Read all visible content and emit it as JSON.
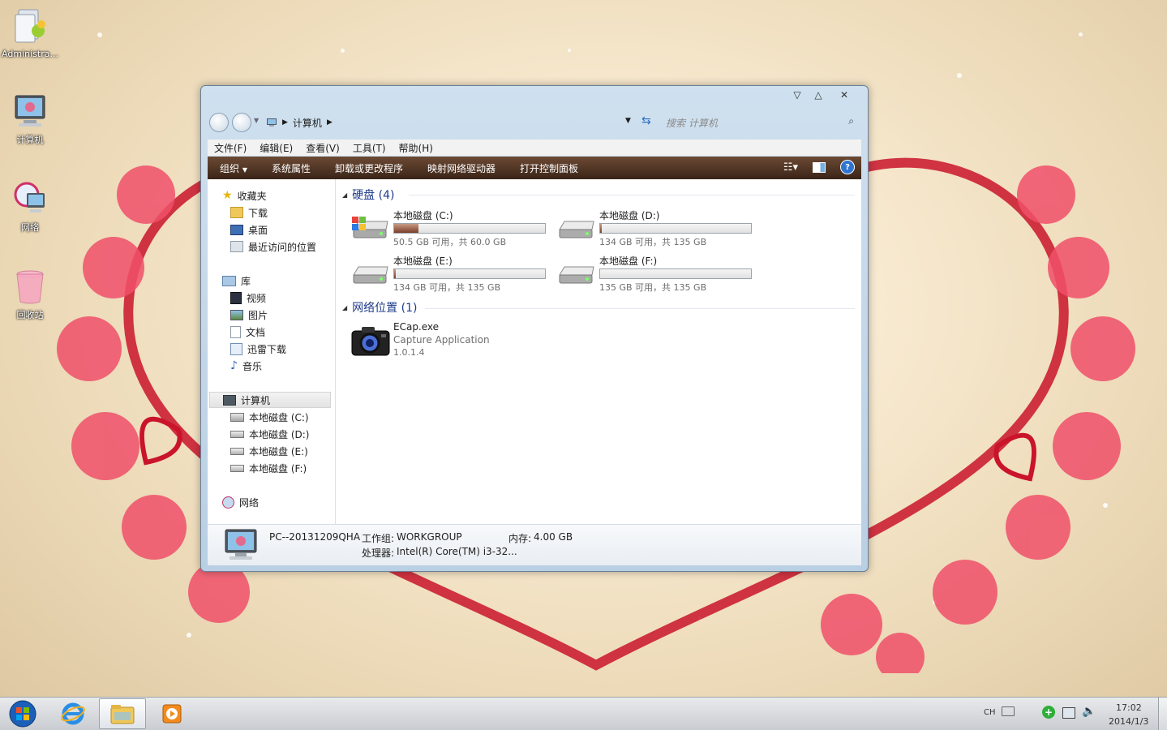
{
  "desktop": {
    "icons": [
      {
        "label": "Administra..."
      },
      {
        "label": "计算机"
      },
      {
        "label": "网络"
      },
      {
        "label": "回收站"
      }
    ]
  },
  "window": {
    "address": {
      "crumb": "计算机"
    },
    "search": {
      "placeholder": "搜索 计算机"
    },
    "menu": [
      "文件(F)",
      "编辑(E)",
      "查看(V)",
      "工具(T)",
      "帮助(H)"
    ],
    "commands": [
      "组织",
      "系统属性",
      "卸载或更改程序",
      "映射网络驱动器",
      "打开控制面板"
    ],
    "nav": {
      "favorites": "收藏夹",
      "favorites_items": [
        "下载",
        "桌面",
        "最近访问的位置"
      ],
      "libraries": "库",
      "library_items": [
        "视频",
        "图片",
        "文档",
        "迅雷下载",
        "音乐"
      ],
      "computer": "计算机",
      "computer_items": [
        "本地磁盘 (C:)",
        "本地磁盘 (D:)",
        "本地磁盘 (E:)",
        "本地磁盘 (F:)"
      ],
      "network": "网络"
    },
    "groups": {
      "drives_title": "硬盘 (4)",
      "network_title": "网络位置 (1)"
    },
    "drives": [
      {
        "name": "本地磁盘 (C:)",
        "caption": "50.5 GB 可用，共 60.0 GB",
        "used_fraction": 0.16
      },
      {
        "name": "本地磁盘 (D:)",
        "caption": "134 GB 可用，共 135 GB",
        "used_fraction": 0.01
      },
      {
        "name": "本地磁盘 (E:)",
        "caption": "134 GB 可用，共 135 GB",
        "used_fraction": 0.01
      },
      {
        "name": "本地磁盘 (F:)",
        "caption": "135 GB 可用，共 135 GB",
        "used_fraction": 0.0
      }
    ],
    "network_item": {
      "name": "ECap.exe",
      "desc": "Capture Application",
      "version": "1.0.1.4"
    },
    "details": {
      "pc_name": "PC--20131209QHA",
      "workgroup_label": "工作组:",
      "workgroup": "WORKGROUP",
      "memory_label": "内存:",
      "memory": "4.00 GB",
      "cpu_label": "处理器:",
      "cpu": "Intel(R) Core(TM) i3-32..."
    }
  },
  "taskbar": {
    "lang": "CH",
    "time": "17:02",
    "date": "2014/1/3"
  },
  "colors": {
    "command_bar": "#4a2f20",
    "group_title": "#1e3b8a",
    "drive_fill": "#8a4b30"
  }
}
